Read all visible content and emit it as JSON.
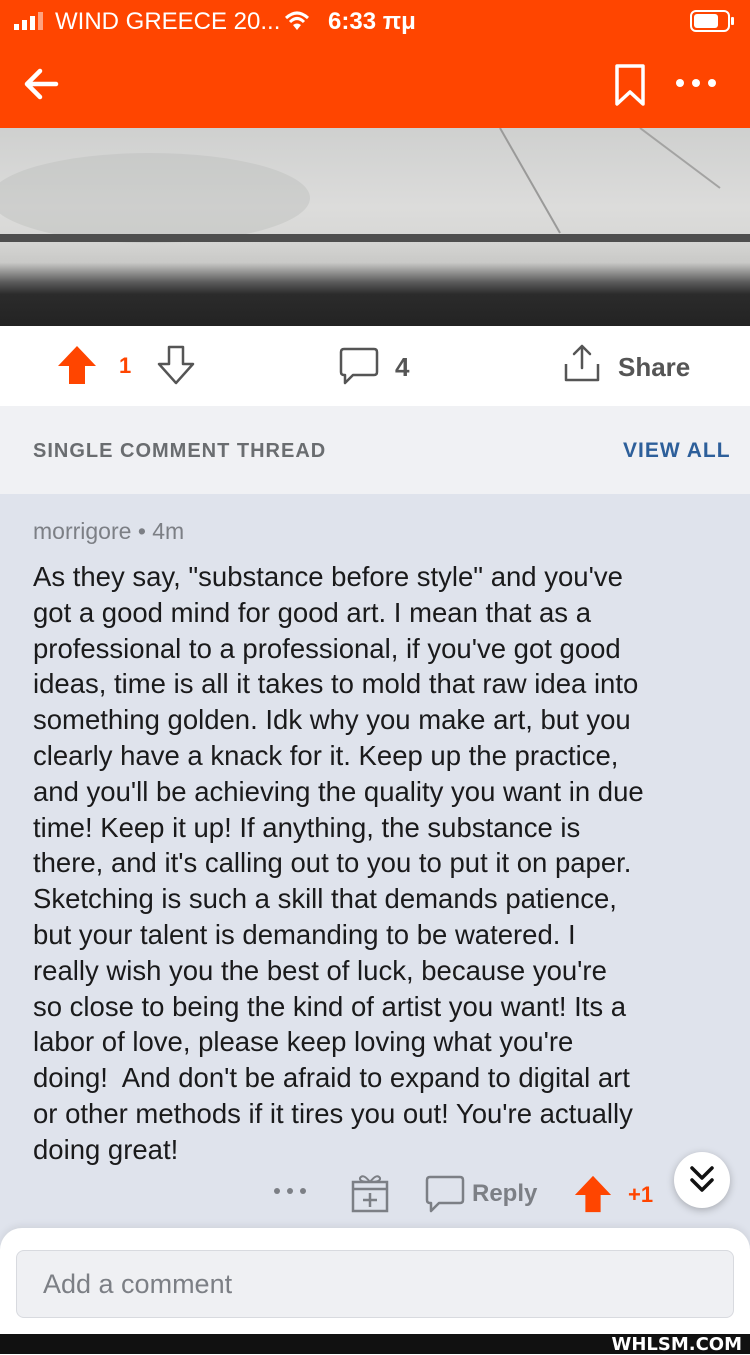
{
  "status_bar": {
    "carrier": "WIND GREECE 20...",
    "time": "6:33 πμ"
  },
  "post_actions": {
    "score": "1",
    "comment_count": "4",
    "share_label": "Share"
  },
  "thread_header": {
    "title": "SINGLE COMMENT THREAD",
    "view_all_label": "VIEW ALL"
  },
  "comment": {
    "author": "morrigore",
    "separator": "•",
    "age": "4m",
    "body": "As they say, \"substance before style\" and you've\ngot a good mind for good art. I mean that as a\nprofessional to a professional, if you've got good\nideas, time is all it takes to mold that raw idea into\nsomething golden. Idk why you make art, but you\nclearly have a knack for it. Keep up the practice,\nand you'll be achieving the quality you want in due\ntime! Keep it up! If anything, the substance is\nthere, and it's calling out to you to put it on paper.\nSketching is such a skill that demands patience,\nbut your talent is demanding to be watered. I\nreally wish you the best of luck, because you're\nso close to being the kind of artist you want! Its a\nlabor of love, please keep loving what you're\ndoing!  And don't be afraid to expand to digital art\nor other methods if it tires you out! You're actually\ndoing great!",
    "more_label": "•••",
    "reply_label": "Reply",
    "score": "+1"
  },
  "composer": {
    "placeholder": "Add a comment"
  },
  "watermark": "WHLSM.COM",
  "colors": {
    "brand": "#ff4500",
    "link": "#2d5f9a",
    "comment_bg": "#dfe3ec"
  }
}
